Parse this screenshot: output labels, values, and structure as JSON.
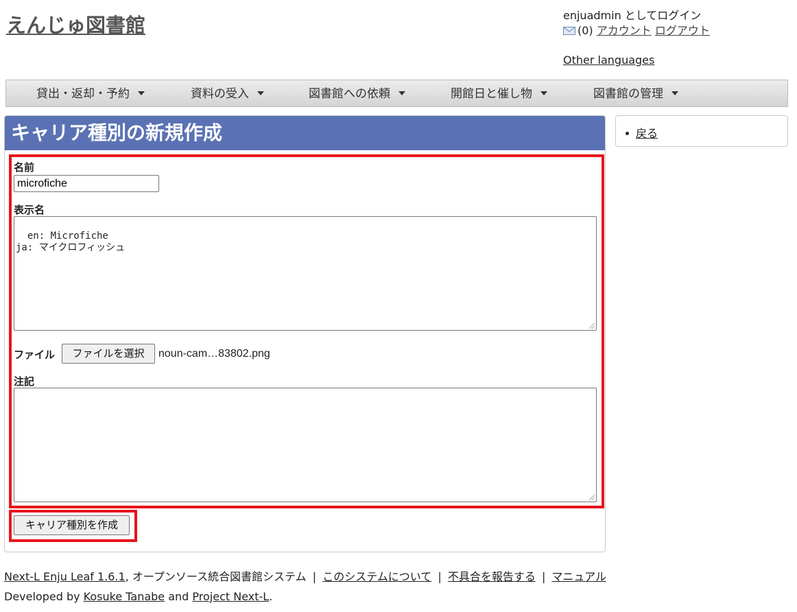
{
  "site": {
    "title": "えんじゅ図書館"
  },
  "user": {
    "login_text": "enjuadmin としてログイン",
    "message_count": "(0)",
    "account_link": "アカウント",
    "logout_link": "ログアウト",
    "other_languages": "Other languages"
  },
  "nav": {
    "items": [
      {
        "label": "貸出・返却・予約"
      },
      {
        "label": "資料の受入"
      },
      {
        "label": "図書館への依頼"
      },
      {
        "label": "開館日と催し物"
      },
      {
        "label": "図書館の管理"
      }
    ]
  },
  "page": {
    "title": "キャリア種別の新規作成"
  },
  "form": {
    "name_label": "名前",
    "name_value": "microfiche",
    "display_name_label": "表示名",
    "display_name_value": "en: Microfiche\nja: マイクロフィッシュ",
    "file_label": "ファイル",
    "file_button": "ファイルを選択",
    "file_name": "noun-cam…83802.png",
    "note_label": "注記",
    "note_value": "",
    "submit_label": "キャリア種別を作成"
  },
  "sidebar": {
    "back_link": "戻る"
  },
  "footer": {
    "product_link": "Next-L Enju Leaf 1.6.1",
    "product_desc": ", オープンソース統合図書館システム",
    "separator": "|",
    "about_link": "このシステムについて",
    "report_link": "不具合を報告する",
    "manual_link": "マニュアル",
    "developed_by": "Developed by ",
    "author_link": "Kosuke Tanabe",
    "and_text": " and ",
    "project_link": "Project Next-L",
    "period": "."
  },
  "colors": {
    "header_bg": "#5a72b4",
    "highlight": "#e8141c"
  }
}
